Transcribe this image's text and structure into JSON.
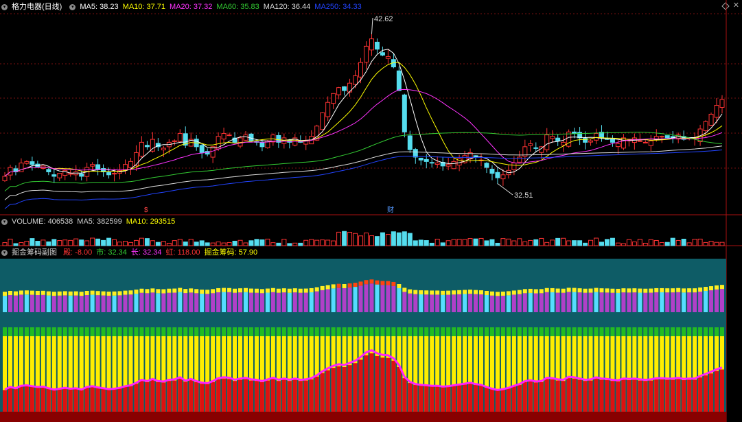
{
  "main": {
    "title": "格力电器(日线)",
    "ma": [
      {
        "label": "MA5: 38.23",
        "color": "#ffffff"
      },
      {
        "label": "MA10: 37.71",
        "color": "#ffff00"
      },
      {
        "label": "MA20: 37.32",
        "color": "#ff33ff"
      },
      {
        "label": "MA60: 35.83",
        "color": "#33cc33"
      },
      {
        "label": "MA120: 36.44",
        "color": "#dddddd"
      },
      {
        "label": "MA250: 34.33",
        "color": "#2244ff"
      }
    ],
    "high_label": "42.62",
    "low_label": "32.51",
    "marker_s": "$",
    "marker_cai": "财"
  },
  "volume": {
    "items": [
      {
        "label": "VOLUME: 406538",
        "color": "#d0d0d0"
      },
      {
        "label": "MA5: 382599",
        "color": "#d0d0d0"
      },
      {
        "label": "MA10: 293515",
        "color": "#ffff00"
      }
    ]
  },
  "indicator": {
    "title": "掘金筹码副图",
    "items": [
      {
        "label": "殿: -8.00",
        "color": "#ff3333"
      },
      {
        "label": "市: 32.34",
        "color": "#33cc33"
      },
      {
        "label": "长: 32.34",
        "color": "#ff33ff"
      },
      {
        "label": "虹: 118.00",
        "color": "#ff3333"
      },
      {
        "label": "掘金筹码: 57.90",
        "color": "#ffff00"
      }
    ]
  },
  "chart_data": {
    "type": "candlestick",
    "title": "格力电器(日线)",
    "ylim": [
      31,
      44
    ],
    "high": 42.62,
    "low": 32.51,
    "close": [
      33.0,
      33.6,
      33.3,
      33.9,
      34.0,
      33.8,
      33.6,
      33.7,
      33.3,
      33.0,
      33.2,
      33.4,
      33.2,
      33.3,
      33.0,
      33.6,
      33.8,
      33.5,
      33.3,
      33.1,
      33.2,
      33.4,
      33.8,
      34.0,
      34.6,
      35.3,
      35.0,
      35.5,
      35.0,
      34.9,
      35.3,
      35.4,
      35.9,
      35.1,
      35.5,
      35.0,
      34.6,
      34.5,
      35.0,
      35.7,
      35.9,
      35.8,
      35.3,
      35.6,
      35.8,
      35.4,
      35.3,
      35.0,
      35.4,
      35.8,
      35.3,
      35.6,
      35.3,
      35.6,
      35.3,
      35.4,
      35.7,
      36.4,
      37.3,
      38.0,
      38.6,
      39.0,
      38.8,
      39.3,
      39.8,
      40.7,
      41.8,
      42.3,
      41.6,
      41.2,
      41.1,
      40.4,
      38.8,
      36.0,
      34.8,
      34.3,
      34.1,
      34.0,
      33.9,
      33.9,
      33.7,
      33.8,
      34.0,
      34.2,
      34.4,
      34.6,
      34.3,
      34.1,
      33.6,
      33.2,
      32.9,
      33.1,
      33.4,
      33.9,
      34.3,
      35.0,
      35.2,
      34.9,
      35.0,
      35.8,
      35.7,
      35.4,
      35.3,
      36.0,
      35.9,
      35.6,
      35.3,
      35.4,
      35.9,
      35.6,
      35.5,
      35.3,
      35.2,
      35.6,
      35.5,
      35.6,
      35.4,
      35.3,
      35.4,
      35.7,
      35.7,
      35.6,
      35.6,
      35.8,
      35.5,
      35.6,
      35.6,
      36.2,
      36.7,
      37.2,
      37.8,
      38.2
    ]
  }
}
